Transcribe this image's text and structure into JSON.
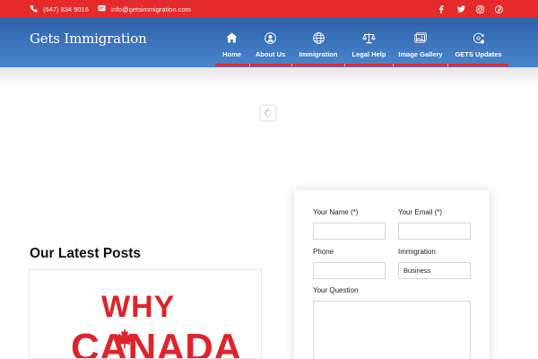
{
  "topbar": {
    "phone": "(647) 834 9016",
    "email": "info@getsimmigration.com",
    "icons": [
      "phone-icon",
      "email-icon",
      "facebook-icon",
      "twitter-icon",
      "instagram-icon",
      "pinterest-icon"
    ],
    "color": "#e42a2a"
  },
  "header": {
    "logo": "Gets Immigration",
    "gradient": [
      "#2e62a9",
      "#4a86cd"
    ],
    "nav": [
      {
        "label": "Home",
        "icon": "home-icon"
      },
      {
        "label": "About Us",
        "icon": "user-icon"
      },
      {
        "label": "Immigration",
        "icon": "globe-icon"
      },
      {
        "label": "Legal Help",
        "icon": "scales-icon"
      },
      {
        "label": "Image Gallery",
        "icon": "gallery-icon"
      },
      {
        "label": "GETS Updates",
        "icon": "updates-icon"
      }
    ]
  },
  "posts": {
    "title": "Our Latest Posts",
    "card_text_1": "WHY",
    "card_text_2": "CANADA"
  },
  "form": {
    "name_label": "Your Name (*)",
    "email_label": "Your Email (*)",
    "phone_label": "Phone",
    "immigration_label": "Immigration",
    "immigration_value": "Business",
    "question_label": "Your Question"
  }
}
